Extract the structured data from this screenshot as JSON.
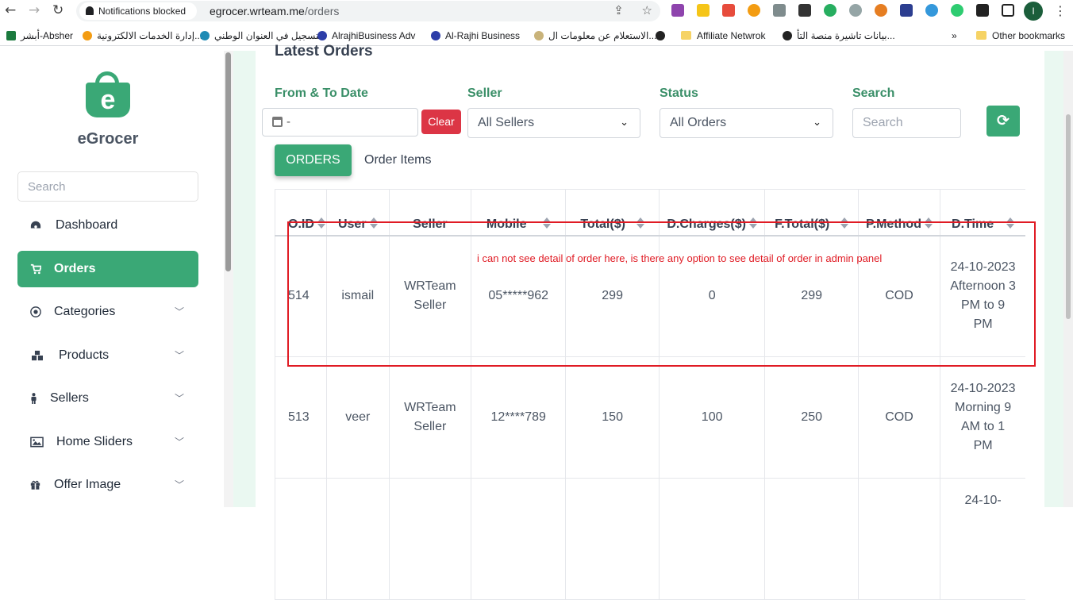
{
  "browser": {
    "notification": "Notifications blocked",
    "url_host": "egrocer.wrteam.me",
    "url_path": "/orders",
    "profile_initial": "I"
  },
  "bookmarks": [
    "أبشر-Absher",
    "إدارة الخدمات الالكترونية...",
    "التسجيل في العنوان الوطني",
    "AlrajhiBusiness Adv",
    "Al-Rajhi Business",
    "الاستعلام عن معلومات ال...",
    "Affiliate Netwrok",
    "بيانات تاشيرة منصة التأ...",
    "»",
    "Other bookmarks"
  ],
  "sidebar": {
    "brand": "eGrocer",
    "logo_letter": "e",
    "search_placeholder": "Search",
    "items": [
      {
        "label": "Dashboard",
        "icon": "dashboard-icon"
      },
      {
        "label": "Orders",
        "icon": "cart-icon"
      },
      {
        "label": "Categories",
        "icon": "categories-icon"
      },
      {
        "label": "Products",
        "icon": "products-icon"
      },
      {
        "label": "Sellers",
        "icon": "sellers-icon"
      },
      {
        "label": "Home Sliders",
        "icon": "image-icon"
      },
      {
        "label": "Offer Image",
        "icon": "gift-icon"
      }
    ]
  },
  "main": {
    "title": "Latest Orders",
    "filters": {
      "date_label": "From & To Date",
      "date_value": "-",
      "clear": "Clear",
      "seller_label": "Seller",
      "seller_value": "All Sellers",
      "status_label": "Status",
      "status_value": "All Orders",
      "search_label": "Search",
      "search_placeholder": "Search"
    },
    "tabs": [
      "ORDERS",
      "Order Items"
    ],
    "columns": [
      "O.ID",
      "User",
      "Seller",
      "Mobile",
      "Total($)",
      "D.Charges($)",
      "F.Total($)",
      "P.Method",
      "D.Time"
    ],
    "rows": [
      {
        "id": "514",
        "user": "ismail",
        "seller": "WRTeam Seller",
        "mobile": "05*****962",
        "total": "299",
        "dcharges": "0",
        "ftotal": "299",
        "pmethod": "COD",
        "dtime": "24-10-2023 Afternoon 3 PM to 9 PM"
      },
      {
        "id": "513",
        "user": "veer",
        "seller": "WRTeam Seller",
        "mobile": "12****789",
        "total": "150",
        "dcharges": "100",
        "ftotal": "250",
        "pmethod": "COD",
        "dtime": "24-10-2023 Morning 9 AM to 1 PM"
      },
      {
        "id": "",
        "user": "",
        "seller": "",
        "mobile": "",
        "total": "",
        "dcharges": "",
        "ftotal": "",
        "pmethod": "",
        "dtime": "24-10-"
      }
    ]
  },
  "annotation": {
    "text": "i can not see detail of order here, is there any option to see detail of order in admin panel",
    "color": "#e01b24"
  },
  "colors": {
    "accent": "#3aa876",
    "danger": "#dc3545",
    "page_bg": "#eaf8f1"
  }
}
